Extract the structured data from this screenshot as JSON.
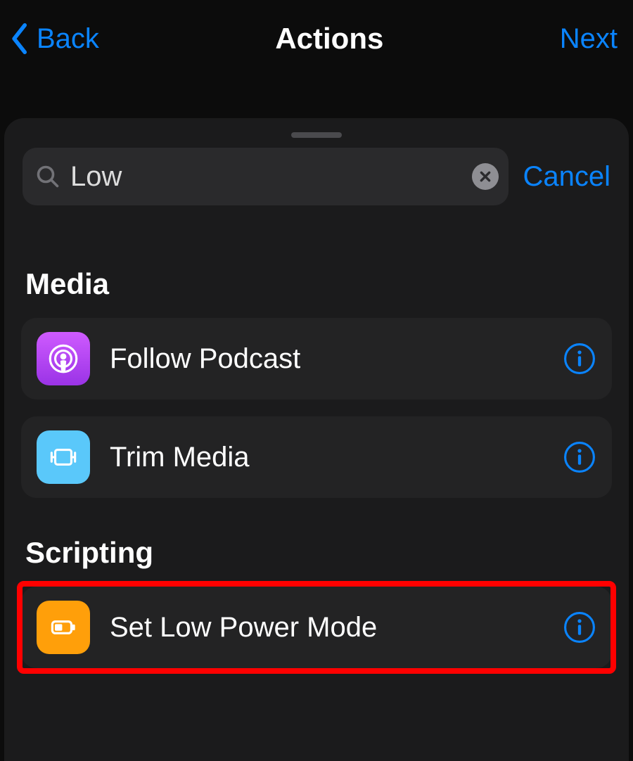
{
  "nav": {
    "back_label": "Back",
    "title": "Actions",
    "next_label": "Next"
  },
  "search": {
    "value": "Low",
    "cancel_label": "Cancel"
  },
  "sections": [
    {
      "title": "Media",
      "items": [
        {
          "label": "Follow Podcast",
          "icon": "podcast-icon"
        },
        {
          "label": "Trim Media",
          "icon": "trim-media-icon"
        }
      ]
    },
    {
      "title": "Scripting",
      "items": [
        {
          "label": "Set Low Power Mode",
          "icon": "low-power-mode-icon",
          "highlighted": true
        }
      ]
    }
  ],
  "colors": {
    "accent": "#0a84ff",
    "podcast": "#af52de",
    "trim": "#5ac8fa",
    "lpm": "#ff9f0a",
    "highlight": "#ff0000"
  }
}
